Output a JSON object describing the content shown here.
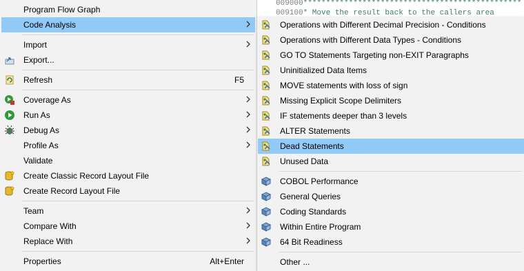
{
  "editor": {
    "line1": {
      "num": "009000",
      "text": "************************************************"
    },
    "line2": {
      "num": "009100",
      "text": "* Move the result back to the callers area"
    }
  },
  "main_menu": {
    "items": [
      {
        "label": "Program Flow Graph",
        "accel": "",
        "submenu": false,
        "icon": "none"
      },
      {
        "label": "Code Analysis",
        "accel": "",
        "submenu": true,
        "icon": "none",
        "highlighted": true
      },
      {
        "label": "Import",
        "accel": "",
        "submenu": true,
        "icon": "none"
      },
      {
        "label": "Export...",
        "accel": "",
        "submenu": false,
        "icon": "export-icon"
      },
      {
        "label": "Refresh",
        "accel": "F5",
        "submenu": false,
        "icon": "refresh-icon"
      },
      {
        "label": "Coverage As",
        "accel": "",
        "submenu": true,
        "icon": "coverage-icon"
      },
      {
        "label": "Run As",
        "accel": "",
        "submenu": true,
        "icon": "run-icon"
      },
      {
        "label": "Debug As",
        "accel": "",
        "submenu": true,
        "icon": "debug-icon"
      },
      {
        "label": "Profile As",
        "accel": "",
        "submenu": true,
        "icon": "none"
      },
      {
        "label": "Validate",
        "accel": "",
        "submenu": false,
        "icon": "none"
      },
      {
        "label": "Create Classic Record Layout File",
        "accel": "",
        "submenu": false,
        "icon": "database-icon"
      },
      {
        "label": "Create Record Layout File",
        "accel": "",
        "submenu": false,
        "icon": "database-icon"
      },
      {
        "label": "Team",
        "accel": "",
        "submenu": true,
        "icon": "none"
      },
      {
        "label": "Compare With",
        "accel": "",
        "submenu": true,
        "icon": "none"
      },
      {
        "label": "Replace With",
        "accel": "",
        "submenu": true,
        "icon": "none"
      },
      {
        "label": "Properties",
        "accel": "Alt+Enter",
        "submenu": false,
        "icon": "none"
      }
    ]
  },
  "submenu": {
    "items": [
      {
        "label": "Operations with Different Decimal Precision - Conditions",
        "icon": "rule-icon"
      },
      {
        "label": "Operations with Different Data Types - Conditions",
        "icon": "rule-icon"
      },
      {
        "label": "GO TO Statements Targeting non-EXIT Paragraphs",
        "icon": "rule-icon"
      },
      {
        "label": "Uninitialized Data Items",
        "icon": "rule-icon"
      },
      {
        "label": "MOVE statements with loss of sign",
        "icon": "rule-icon"
      },
      {
        "label": "Missing Explicit Scope Delimiters",
        "icon": "rule-icon"
      },
      {
        "label": "IF statements deeper than 3 levels",
        "icon": "rule-icon"
      },
      {
        "label": "ALTER Statements",
        "icon": "rule-icon"
      },
      {
        "label": "Dead Statements",
        "icon": "rule-icon",
        "highlighted": true
      },
      {
        "label": "Unused Data",
        "icon": "rule-icon"
      },
      {
        "label": "COBOL Performance",
        "icon": "book-icon"
      },
      {
        "label": "General Queries",
        "icon": "book-icon"
      },
      {
        "label": "Coding Standards",
        "icon": "book-icon"
      },
      {
        "label": "Within Entire Program",
        "icon": "book-icon"
      },
      {
        "label": "64 Bit Readiness",
        "icon": "book-icon"
      },
      {
        "label": "Other ...",
        "icon": "none"
      }
    ]
  },
  "colors": {
    "highlight": "#91c9f7",
    "menu_bg": "#f2f2f2",
    "separator": "#d7d7d7"
  }
}
